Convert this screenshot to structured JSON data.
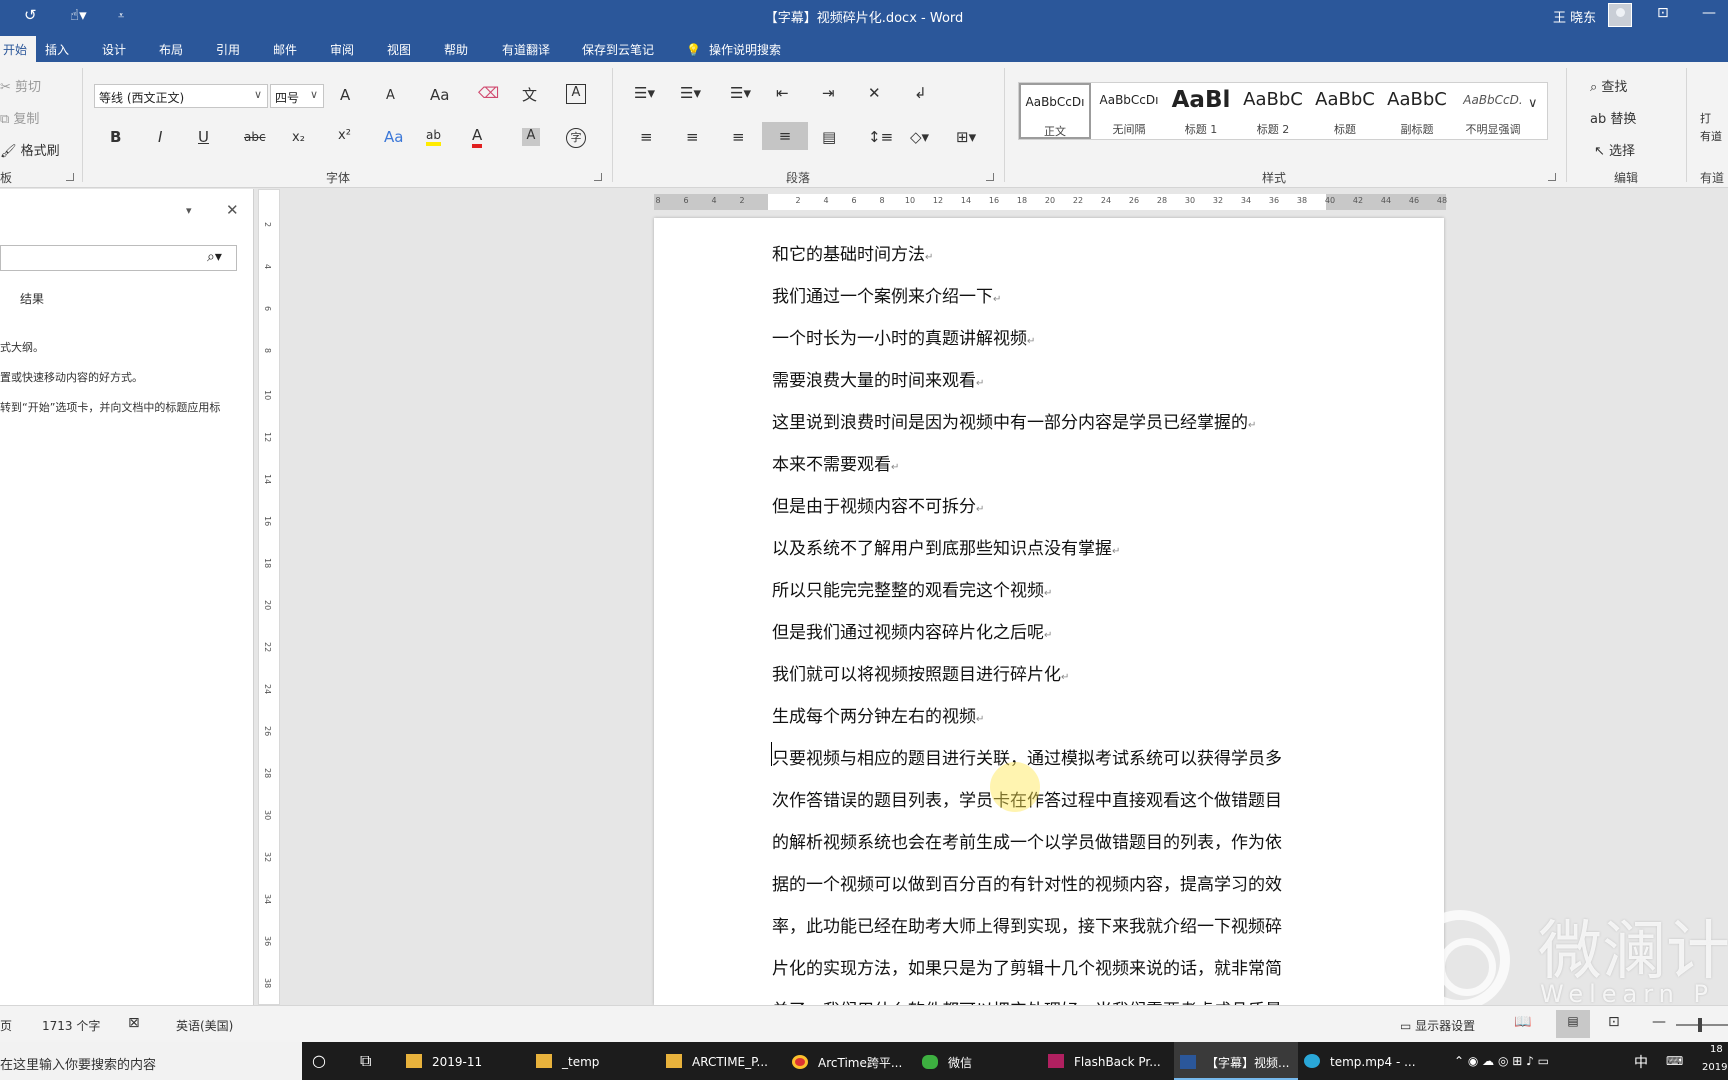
{
  "window": {
    "title": "【字幕】视频碎片化.docx  -  Word",
    "user": "王 晓东",
    "minimize": "—",
    "maximize": "□"
  },
  "ribbon_tabs": [
    "开始",
    "插入",
    "设计",
    "布局",
    "引用",
    "邮件",
    "审阅",
    "视图",
    "帮助",
    "有道翻译",
    "保存到云笔记",
    "操作说明搜索"
  ],
  "clipboard": {
    "cut": "剪切",
    "copy": "复制",
    "format_painter": "格式刷",
    "label": "板"
  },
  "font": {
    "name": "等线 (西文正文)",
    "size": "四号",
    "label": "字体",
    "bold": "B",
    "italic": "I",
    "underline": "U",
    "strike": "abc",
    "subscript": "x₂",
    "superscript": "x²",
    "grow": "A",
    "shrink": "A",
    "case": "Aa",
    "phonetic": "文",
    "border": "A",
    "highlight": "ab",
    "color": "A",
    "shade": "A",
    "enclose": "字"
  },
  "paragraph": {
    "label": "段落"
  },
  "styles": {
    "label": "样式",
    "items": [
      {
        "preview": "AaBbCcDı",
        "name": "正文"
      },
      {
        "preview": "AaBbCcDı",
        "name": "无间隔"
      },
      {
        "preview": "AaBl",
        "name": "标题 1"
      },
      {
        "preview": "AaBbC",
        "name": "标题 2"
      },
      {
        "preview": "AaBbC",
        "name": "标题"
      },
      {
        "preview": "AaBbC",
        "name": "副标题"
      },
      {
        "preview": "AaBbCcD.",
        "name": "不明显强调"
      }
    ]
  },
  "editing": {
    "find": "查找",
    "replace": "替换",
    "select": "选择",
    "label": "编辑"
  },
  "youdao": {
    "open": "打",
    "label": "有道",
    "label2": "有道"
  },
  "navpane": {
    "results_tab": "结果",
    "line1": "式大纲。",
    "line2": "置或快速移动内容的好方式。",
    "line3": "转到“开始”选项卡，并向文档中的标题应用标"
  },
  "hruler_ticks": [
    "8",
    "6",
    "4",
    "2",
    "",
    "2",
    "4",
    "6",
    "8",
    "10",
    "12",
    "14",
    "16",
    "18",
    "20",
    "22",
    "24",
    "26",
    "28",
    "30",
    "32",
    "34",
    "36",
    "38",
    "40",
    "42",
    "44",
    "46",
    "48"
  ],
  "vruler_ticks": [
    "2",
    "4",
    "6",
    "8",
    "10",
    "12",
    "14",
    "16",
    "18",
    "20",
    "22",
    "24",
    "26",
    "28",
    "30",
    "32",
    "34",
    "36",
    "38"
  ],
  "document": {
    "lines": [
      "和它的基础时间方法",
      "我们通过一个案例来介绍一下",
      "一个时长为一小时的真题讲解视频",
      "需要浪费大量的时间来观看",
      "这里说到浪费时间是因为视频中有一部分内容是学员已经掌握的",
      "本来不需要观看",
      "但是由于视频内容不可拆分",
      "以及系统不了解用户到底那些知识点没有掌握",
      "所以只能完完整整的观看完这个视频",
      "但是我们通过视频内容碎片化之后呢",
      "我们就可以将视频按照题目进行碎片化",
      "生成每个两分钟左右的视频"
    ],
    "para_mark": "↵",
    "body_lines": [
      "只要视频与相应的题目进行关联，通过模拟考试系统可以获得学员多",
      "次作答错误的题目列表，学员卡在作答过程中直接观看这个做错题目",
      "的解析视频系统也会在考前生成一个以学员做错题目的列表，作为依",
      "据的一个视频可以做到百分百的有针对性的视频内容，提高学习的效",
      "率，此功能已经在助考大师上得到实现，接下来我就介绍一下视频碎",
      "片化的实现方法，如果只是为了剪辑十几个视频来说的话，就非常简",
      "单了，我们用什么软件都可以把它处理好，当我们需要考虑成品质量"
    ]
  },
  "watermark": {
    "brand": "微澜计",
    "latin": "Welearn P"
  },
  "statusbar": {
    "page": "页",
    "words": "1713 个字",
    "lang": "英语(美国)",
    "display": "显示器设置"
  },
  "taskbar": {
    "search_placeholder": "在这里输入你要搜索的内容",
    "apps": [
      "2019-11",
      "_temp",
      "ARCTIME_P...",
      "ArcTime跨平...",
      "微信",
      "FlashBack Pr...",
      "【字幕】视频...",
      "temp.mp4 - ..."
    ],
    "ime": "中",
    "time": "18",
    "date": "2019"
  },
  "colors": {
    "word_blue": "#2b579a",
    "ribbon_bg": "#f3f3f3",
    "taskbar_bg": "#1c1c1c"
  }
}
